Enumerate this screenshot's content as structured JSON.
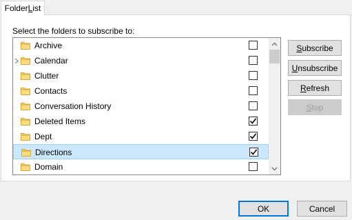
{
  "tab": {
    "pre": "Folder ",
    "accel": "L",
    "post": "ist"
  },
  "prompt": "Select the folders to subscribe to:",
  "folders": [
    {
      "name": "Archive",
      "checked": false,
      "expandable": false,
      "selected": false
    },
    {
      "name": "Calendar",
      "checked": false,
      "expandable": true,
      "selected": false
    },
    {
      "name": "Clutter",
      "checked": false,
      "expandable": false,
      "selected": false
    },
    {
      "name": "Contacts",
      "checked": false,
      "expandable": false,
      "selected": false
    },
    {
      "name": "Conversation History",
      "checked": false,
      "expandable": false,
      "selected": false
    },
    {
      "name": "Deleted Items",
      "checked": true,
      "expandable": false,
      "selected": false
    },
    {
      "name": "Dept",
      "checked": true,
      "expandable": false,
      "selected": false
    },
    {
      "name": "Directions",
      "checked": true,
      "expandable": false,
      "selected": true
    },
    {
      "name": "Domain",
      "checked": false,
      "expandable": false,
      "selected": false
    }
  ],
  "side_buttons": {
    "subscribe": {
      "accel": "S",
      "rest": "ubscribe",
      "enabled": true
    },
    "unsubscribe": {
      "accel": "U",
      "rest": "nsubscribe",
      "enabled": true
    },
    "refresh": {
      "accel": "R",
      "rest": "efresh",
      "enabled": true
    },
    "stop": {
      "accel": "S",
      "rest": "top",
      "enabled": false
    }
  },
  "buttons": {
    "ok": "OK",
    "cancel": "Cancel"
  },
  "colors": {
    "selection": "#cce8ff",
    "selection_border": "#99d1ff",
    "folder": "#f7d36b",
    "default_border": "#0078d7"
  },
  "icons": {
    "folder": "folder-icon",
    "expander": "chevron-right-icon",
    "check": "checkmark-icon"
  }
}
